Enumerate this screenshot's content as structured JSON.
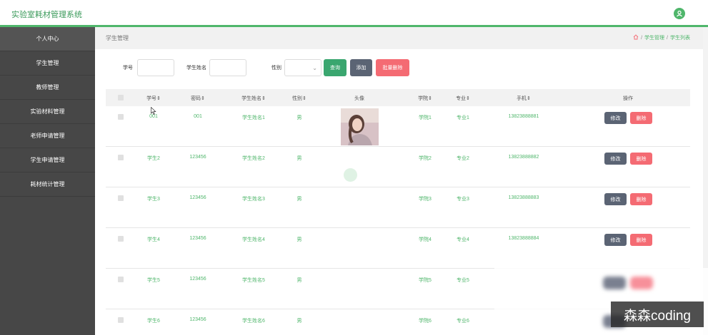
{
  "app": {
    "title": "实验室耗材管理系统"
  },
  "sidebar": {
    "items": [
      {
        "label": "个人中心"
      },
      {
        "label": "学生管理"
      },
      {
        "label": "教师管理"
      },
      {
        "label": "实验材料管理"
      },
      {
        "label": "老师申请管理"
      },
      {
        "label": "学生申请管理"
      },
      {
        "label": "耗材统计管理"
      }
    ]
  },
  "breadcrumb": {
    "title": "学生管理",
    "path": [
      "学生管理",
      "学生列表"
    ],
    "sep": "/"
  },
  "filter": {
    "student_no_label": "学号",
    "student_no_value": "",
    "student_name_label": "学生姓名",
    "student_name_value": "",
    "gender_label": "性别",
    "gender_value": ""
  },
  "buttons": {
    "search": "查询",
    "add": "添加",
    "batch_delete": "批量删除",
    "edit": "修改",
    "delete": "删除"
  },
  "colors": {
    "accent": "#4fb66b",
    "search": "#3aa66f",
    "add": "#5b6474",
    "danger": "#f46b73"
  },
  "table": {
    "headers": [
      "学号",
      "密码",
      "学生姓名",
      "性别",
      "头像",
      "学院",
      "专业",
      "手机",
      "操作"
    ],
    "rows": [
      {
        "no": "001",
        "password": "001",
        "name": "学生姓名1",
        "gender": "男",
        "college": "学院1",
        "major": "专业1",
        "phone": "13823888881",
        "has_avatar": true
      },
      {
        "no": "学生2",
        "password": "123456",
        "name": "学生姓名2",
        "gender": "男",
        "college": "学院2",
        "major": "专业2",
        "phone": "13823888882",
        "has_avatar": false
      },
      {
        "no": "学生3",
        "password": "123456",
        "name": "学生姓名3",
        "gender": "男",
        "college": "学院3",
        "major": "专业3",
        "phone": "13823888883",
        "has_avatar": false
      },
      {
        "no": "学生4",
        "password": "123456",
        "name": "学生姓名4",
        "gender": "男",
        "college": "学院4",
        "major": "专业4",
        "phone": "13823888884",
        "has_avatar": false
      },
      {
        "no": "学生5",
        "password": "123456",
        "name": "学生姓名5",
        "gender": "男",
        "college": "学院5",
        "major": "专业5",
        "phone": "",
        "has_avatar": false
      },
      {
        "no": "学生6",
        "password": "123456",
        "name": "学生姓名6",
        "gender": "男",
        "college": "学院6",
        "major": "专业6",
        "phone": "",
        "has_avatar": false
      }
    ]
  },
  "icons": {
    "user": "user-icon",
    "home": "home-icon",
    "chevron": "chevron-down-icon",
    "sort": "sort-icon"
  },
  "watermark": {
    "text": "森森coding"
  }
}
